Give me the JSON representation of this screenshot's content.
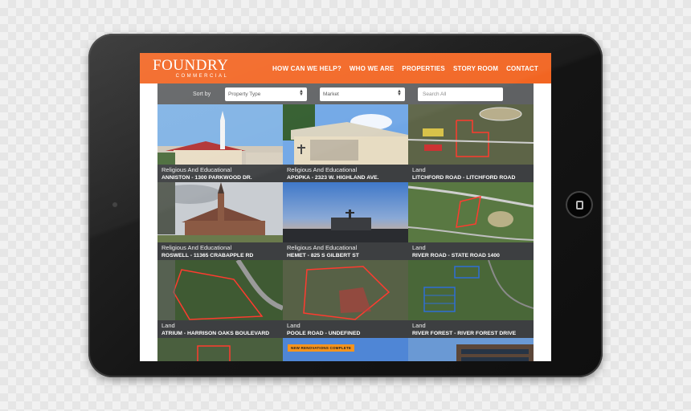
{
  "header": {
    "brand": "FOUNDRY",
    "brand_sub": "COMMERCIAL",
    "nav": [
      "HOW CAN WE HELP?",
      "WHO WE ARE",
      "PROPERTIES",
      "STORY ROOM",
      "CONTACT"
    ]
  },
  "filters": {
    "sort_label": "Sort by",
    "property_type": "Property Type",
    "market": "Market",
    "search_placeholder": "Search All"
  },
  "properties": [
    {
      "category": "Religious And Educational",
      "address": "ANNISTON - 1300 PARKWOOD DR."
    },
    {
      "category": "Religious And Educational",
      "address": "APOPKA - 2323 W. HIGHLAND AVE."
    },
    {
      "category": "Land",
      "address": "LITCHFORD ROAD - LITCHFORD ROAD"
    },
    {
      "category": "Religious And Educational",
      "address": "ROSWELL - 11365 CRABAPPLE RD"
    },
    {
      "category": "Religious And Educational",
      "address": "HEMET - 825 S GILBERT ST"
    },
    {
      "category": "Land",
      "address": "RIVER ROAD - STATE ROAD 1400"
    },
    {
      "category": "Land",
      "address": "ATRIUM - HARRISON OAKS BOULEVARD"
    },
    {
      "category": "Land",
      "address": "POOLE ROAD - UNDEFINED"
    },
    {
      "category": "Land",
      "address": "RIVER FOREST - RIVER FOREST DRIVE"
    }
  ],
  "partial_row": {
    "badge": "NEW RENOVATIONS COMPLETE"
  },
  "colors": {
    "brand_orange": "#f26522",
    "filter_bar": "#5f6163",
    "caption_bg": "#3d3f41"
  }
}
